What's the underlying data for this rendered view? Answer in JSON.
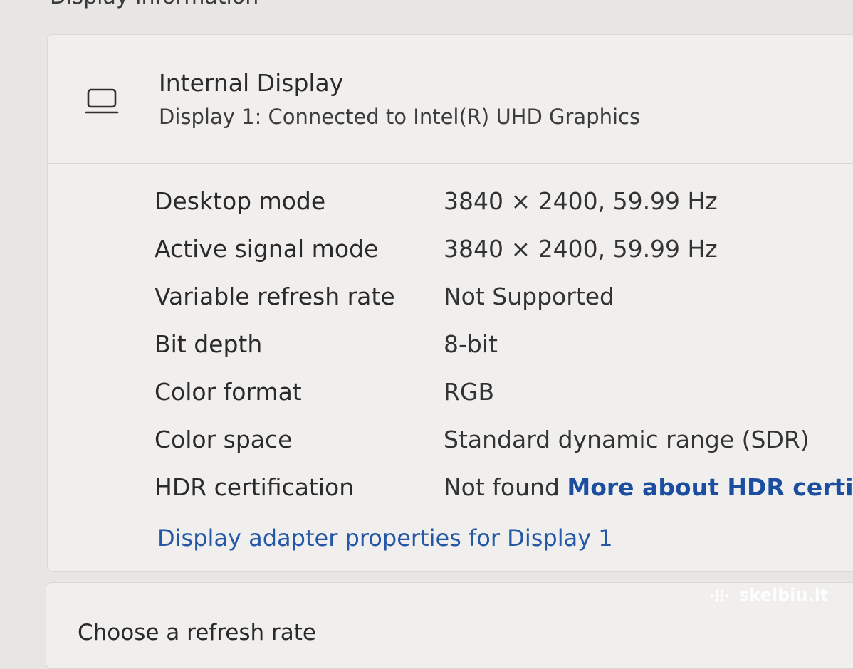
{
  "section": {
    "heading": "Display information"
  },
  "display": {
    "icon": "laptop-display-icon",
    "title": "Internal Display",
    "subtitle": "Display 1: Connected to Intel(R) UHD Graphics"
  },
  "properties": [
    {
      "label": "Desktop mode",
      "value": "3840 × 2400, 59.99 Hz"
    },
    {
      "label": "Active signal mode",
      "value": "3840 × 2400, 59.99 Hz"
    },
    {
      "label": "Variable refresh rate",
      "value": "Not Supported"
    },
    {
      "label": "Bit depth",
      "value": "8-bit"
    },
    {
      "label": "Color format",
      "value": "RGB"
    },
    {
      "label": "Color space",
      "value": "Standard dynamic range (SDR)"
    },
    {
      "label": "HDR certification",
      "value": "Not found",
      "link": "More about HDR certifica"
    }
  ],
  "adapter_link": "Display adapter properties for Display 1",
  "refresh": {
    "label": "Choose a refresh rate"
  },
  "watermark": {
    "text": "skelbiu.lt"
  },
  "colors": {
    "background": "#e7e6e4",
    "card": "#f0efed",
    "link": "#1c4ea0"
  }
}
